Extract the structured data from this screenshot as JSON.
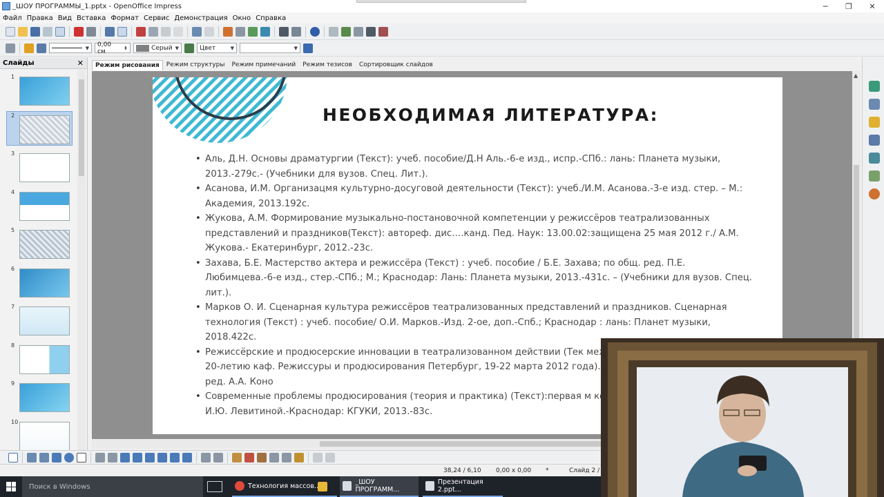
{
  "window": {
    "title": "_ШОУ ПРОГРАММЫ_1.pptx - OpenOffice Impress",
    "minimize": "─",
    "maximize": "❐",
    "close": "✕"
  },
  "menu": [
    "Файл",
    "Правка",
    "Вид",
    "Вставка",
    "Формат",
    "Сервис",
    "Демонстрация",
    "Окно",
    "Справка"
  ],
  "line_toolbar": {
    "width_value": "0,00 см",
    "color_value": "Серый",
    "area_style": "Цвет",
    "area_value": ""
  },
  "slides_panel": {
    "title": "Слайды",
    "close": "✕",
    "numbers": [
      "1",
      "2",
      "3",
      "4",
      "5",
      "6",
      "7",
      "8",
      "9",
      "10"
    ],
    "selected": 2
  },
  "mode_tabs": [
    "Режим рисования",
    "Режим структуры",
    "Режим примечаний",
    "Режим тезисов",
    "Сортировщик слайдов"
  ],
  "slide": {
    "title": "НЕОБХОДИМАЯ ЛИТЕРАТУРА:",
    "references": [
      "Аль, Д.Н. Основы драматургии (Текст): учеб. пособие/Д.Н Аль.-6-е изд., испр.-СПб.: лань: Планета музыки, 2013.-279с.- (Учебники для вузов. Спец. Лит.).",
      "Асанова, И.М. Организацмя культурно-досуговой деятельности (Текст): учеб./И.М. Асанова.-3-е изд. стер. – М.: Академия, 2013.192с.",
      "Жукова, А.М. Формирование музыкально-постановочной компетенции у режиссёров театрализованных представлений и праздников(Текст): автореф. дис….канд. Пед. Наук: 13.00.02:защищена 25 мая 2012 г./ А.М. Жукова.- Екатеринбург, 2012.-23с.",
      "Захава, Б.Е. Мастерство актера и режиссёра (Текст) : учеб. пособие / Б.Е. Захава; по общ. ред. П.Е. Любимцева.-6-е изд., стер.-СПб.; М.; Краснодар: Лань: Планета музыки, 2013.-431с. – (Учебники для вузов. Спец. лит.).",
      "Марков О. И. Сценарная культура режиссёров театрализованных представлений и праздников. Сценарная технология (Текст) : учеб. пособие/ О.И. Марков.-Изд. 2-ое, доп.-Спб.; Краснодар : лань: Планет музыки, 2018.422с.",
      "Режиссёрские и продюсерские инновации в театрализованном действии (Тек междунаро. научн.-практ. конф. к 20-летию каф. Режиссуры и продюсирования Петербург, 19-22 марта 2012 года). Т. 194: Труды СПБГУКИ/науч. ред. А.А. Коно",
      "Современные проблемы продюсирования (теория и практика) (Текст):первая м конф.: сб. ст./ под. Общ. Ред. И.Ю. Левитиной.-Краснодар: КГУКИ, 2013.-83с."
    ],
    "accent_color": "#3fb9d3",
    "ring_color": "#2b3d4a"
  },
  "status": {
    "position": "38,24 / 6,10",
    "size": "0,00 x 0,00",
    "modified": "*",
    "slide_info": "Слайд 2 / 3"
  },
  "taskbar": {
    "search_placeholder": "Поиск в Windows",
    "apps": [
      {
        "label": "Технология массов...",
        "icon": "chrome-icon"
      },
      {
        "label": "",
        "icon": "file-explorer-icon"
      },
      {
        "label": "_ШОУ ПРОГРАММ...",
        "icon": "openoffice-icon"
      },
      {
        "label": "Презентация 2.ppt...",
        "icon": "openoffice-icon"
      }
    ]
  }
}
